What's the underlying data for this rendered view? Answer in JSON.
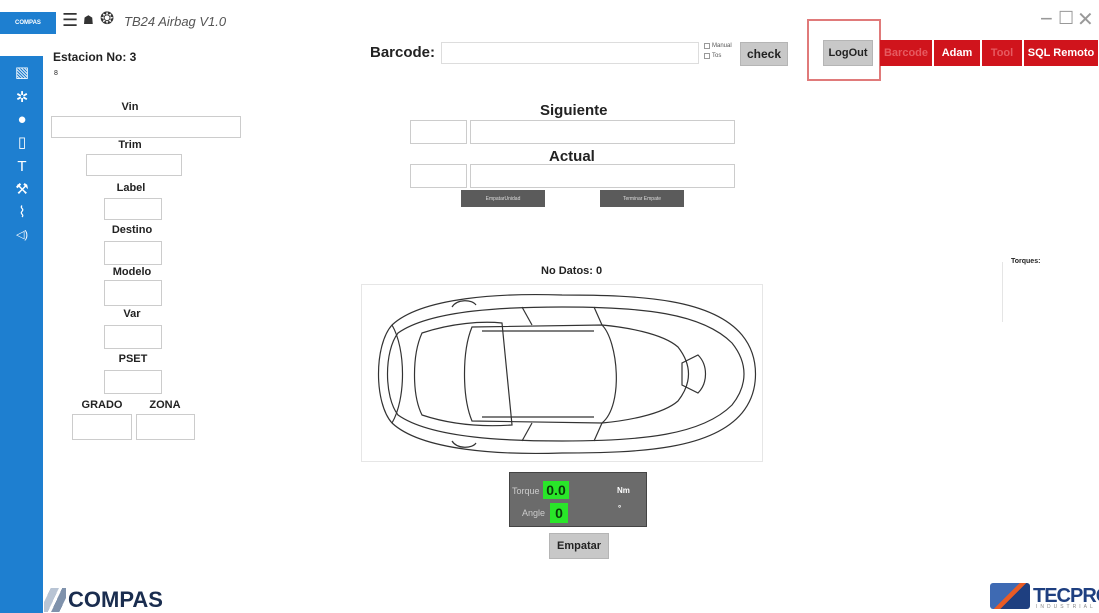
{
  "app": {
    "logo_text": "COMPAS",
    "title": "TB24 Airbag V1.0"
  },
  "header": {
    "station": "Estacion No: 3",
    "tiny": "8",
    "barcode_label": "Barcode:",
    "barcode_value": "",
    "options": [
      "Manual",
      "Tos"
    ],
    "check_label": "check",
    "logout_label": "LogOut",
    "red_buttons": [
      "Barcode",
      "Adam",
      "Tool",
      "SQL Remoto"
    ]
  },
  "fields": {
    "vin": "Vin",
    "trim": "Trim",
    "label": "Label",
    "destino": "Destino",
    "modelo": "Modelo",
    "var": "Var",
    "pset": "PSET",
    "grado": "GRADO",
    "zona": "ZONA"
  },
  "center": {
    "siguiente": "Siguiente",
    "actual": "Actual",
    "btn_left": "EmpatarUnidad",
    "btn_right": "Terminar Empate",
    "no_datos": "No Datos: 0"
  },
  "torque": {
    "torque_label": "Torque",
    "torque_value": "0.0",
    "torque_unit": "Nm",
    "angle_label": "Angle",
    "angle_value": "0",
    "angle_unit": "°"
  },
  "empatar_label": "Empatar",
  "torques_label": "Torques:",
  "footer": {
    "compas": "COMPAS",
    "tecpro": "TECPRO",
    "tecpro_sub": "INDUSTRIAL"
  },
  "colors": {
    "sidebar": "#1e7fd0",
    "red_button": "#d0141c",
    "gauge_green": "#29e629"
  }
}
